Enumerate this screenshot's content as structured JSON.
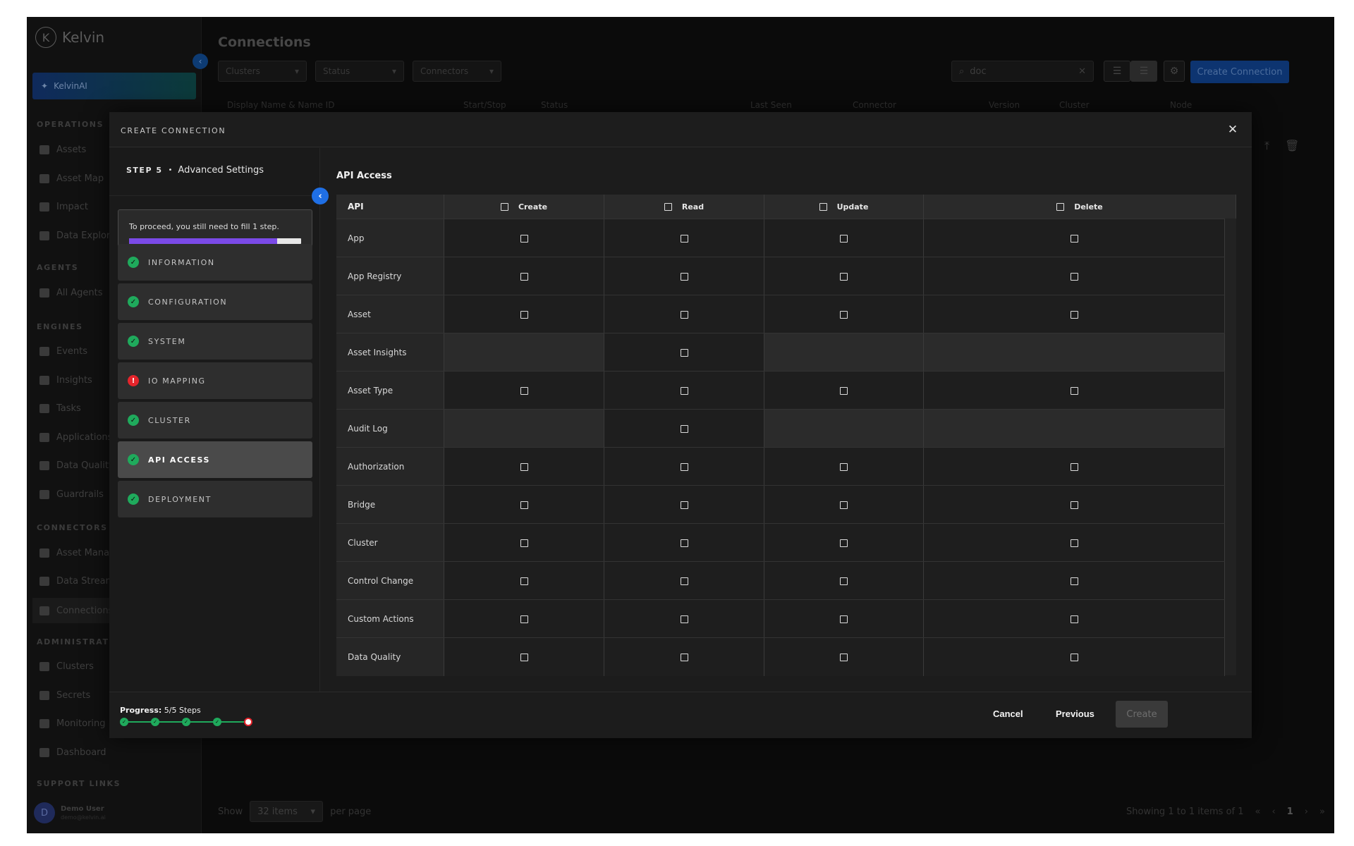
{
  "app": {
    "logo_text": "Kelvin",
    "ai_button": "KelvinAI",
    "sections": {
      "operations": "OPERATIONS",
      "agents": "AGENTS",
      "engines": "ENGINES",
      "connectors": "CONNECTORS",
      "administration": "ADMINISTRATIO",
      "support": "SUPPORT LINKS"
    },
    "nav": {
      "assets": "Assets",
      "asset_map": "Asset Map",
      "impact": "Impact",
      "data_explorer": "Data Explore",
      "all_agents": "All Agents",
      "events": "Events",
      "insights": "Insights",
      "tasks": "Tasks",
      "applications": "Applications",
      "data_quality": "Data Quality",
      "guardrails": "Guardrails",
      "asset_manager": "Asset Manag",
      "data_streams": "Data Stream",
      "connections": "Connections",
      "clusters": "Clusters",
      "secrets": "Secrets",
      "monitoring": "Monitoring",
      "dashboard": "Dashboard"
    },
    "user": {
      "initial": "D",
      "name": "Demo User",
      "email": "demo@kelvin.ai"
    }
  },
  "page": {
    "title": "Connections",
    "filters": [
      "Clusters",
      "Status",
      "Connectors"
    ],
    "search_value": "doc",
    "create_button": "Create Connection",
    "columns": [
      "Display Name & Name ID",
      "Start/Stop",
      "Status",
      "Last Seen",
      "Connector",
      "Version",
      "Cluster",
      "Node"
    ],
    "pagination": {
      "show": "Show",
      "items": "32 items",
      "per_page": "per page",
      "showing": "Showing 1 to 1 items of 1",
      "page": "1"
    }
  },
  "modal": {
    "title": "CREATE CONNECTION",
    "step_label": "STEP 5",
    "step_name": "Advanced Settings",
    "warning": "To proceed, you still need to fill 1 step.",
    "progress_fraction": 0.86,
    "steps": [
      {
        "label": "INFORMATION",
        "status": "complete"
      },
      {
        "label": "CONFIGURATION",
        "status": "complete"
      },
      {
        "label": "SYSTEM",
        "status": "complete"
      },
      {
        "label": "IO MAPPING",
        "status": "error"
      },
      {
        "label": "CLUSTER",
        "status": "complete"
      },
      {
        "label": "API ACCESS",
        "status": "complete",
        "active": true
      },
      {
        "label": "DEPLOYMENT",
        "status": "complete"
      }
    ],
    "section_title": "API Access",
    "table": {
      "api_header": "API",
      "columns": [
        "Create",
        "Read",
        "Update",
        "Delete"
      ],
      "rows": [
        {
          "name": "App",
          "perms": [
            true,
            true,
            true,
            true
          ]
        },
        {
          "name": "App Registry",
          "perms": [
            true,
            true,
            true,
            true
          ]
        },
        {
          "name": "Asset",
          "perms": [
            true,
            true,
            true,
            true
          ]
        },
        {
          "name": "Asset Insights",
          "perms": [
            false,
            true,
            false,
            false
          ]
        },
        {
          "name": "Asset Type",
          "perms": [
            true,
            true,
            true,
            true
          ]
        },
        {
          "name": "Audit Log",
          "perms": [
            false,
            true,
            false,
            false
          ]
        },
        {
          "name": "Authorization",
          "perms": [
            true,
            true,
            true,
            true
          ]
        },
        {
          "name": "Bridge",
          "perms": [
            true,
            true,
            true,
            true
          ]
        },
        {
          "name": "Cluster",
          "perms": [
            true,
            true,
            true,
            true
          ]
        },
        {
          "name": "Control Change",
          "perms": [
            true,
            true,
            true,
            true
          ]
        },
        {
          "name": "Custom Actions",
          "perms": [
            true,
            true,
            true,
            true
          ]
        },
        {
          "name": "Data Quality",
          "perms": [
            true,
            true,
            true,
            true
          ]
        }
      ]
    },
    "footer": {
      "progress_label": "Progress:",
      "progress_value": "5/5 Steps",
      "cancel": "Cancel",
      "previous": "Previous",
      "create": "Create"
    }
  },
  "icons": {
    "close": "close-icon",
    "check": "check-icon",
    "error": "error-icon",
    "chevron_left": "chevron-left-icon"
  },
  "colors": {
    "success": "#1faa5c",
    "error": "#e5242b",
    "progress": "#7b4ae8",
    "accent": "#1f6fe5"
  }
}
